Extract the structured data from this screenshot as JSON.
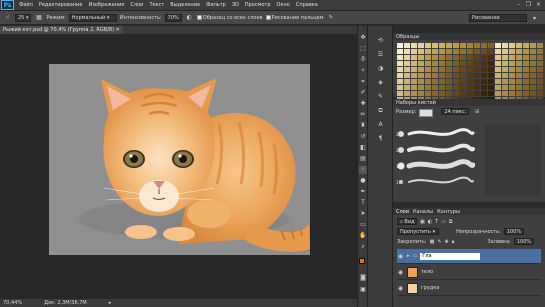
{
  "app": {
    "logo": "Ps"
  },
  "menu": [
    "Файл",
    "Редактирование",
    "Изображение",
    "Слои",
    "Текст",
    "Выделение",
    "Фильтр",
    "3D",
    "Просмотр",
    "Окно",
    "Справка"
  ],
  "window_controls": {
    "minimize": "–",
    "restore": "❐",
    "close": "✕"
  },
  "options_bar": {
    "brush_size": "25",
    "mode_label": "Режим:",
    "mode_value": "Нормальный",
    "strength_label": "Интенсивность:",
    "strength_value": "70%",
    "sample_all_layers": "Образец со всех слоев",
    "finger_painting": "Рисование пальцем",
    "workspace": "Рисование"
  },
  "document": {
    "tab_title": "Рыжий кот.psd @ 70,4% (Группа 2, RGB/8)",
    "zoom": "70,44%",
    "doc_info": "Док: 2,3M/36,7M"
  },
  "swatches_panel": {
    "title": "Образцы",
    "colors": [
      "#f5f0e0",
      "#efe6c8",
      "#e8dca8",
      "#e3d490",
      "#dccb78",
      "#d6c164",
      "#cfb652",
      "#c6aa44",
      "#bd9e38",
      "#b3922e",
      "#a88626",
      "#9c7a20",
      "#8f6e1b",
      "#826217",
      "#f3eac6",
      "#e9dba4",
      "#ddcb86",
      "#d1bb6c",
      "#c4ab58",
      "#b69b48",
      "#a78b3c",
      "#f6efd8",
      "#ede0b4",
      "#e2d08c",
      "#d8c06c",
      "#cdb05a",
      "#c3a24c",
      "#b9943e",
      "#ae8834",
      "#a27c2c",
      "#966f25",
      "#8a641f",
      "#7d581a",
      "#714d16",
      "#654212",
      "#e9d9a6",
      "#dcc784",
      "#cfb568",
      "#c1a452",
      "#b39442",
      "#a58436",
      "#97762c",
      "#f0e7c4",
      "#e4d49e",
      "#d7c17c",
      "#caaf62",
      "#bd9e4e",
      "#b08f40",
      "#a28034",
      "#94722a",
      "#866422",
      "#78571b",
      "#6b4b16",
      "#5e4011",
      "#52360e",
      "#472d0b",
      "#e2cf90",
      "#d4bc72",
      "#c6aa5c",
      "#b89a4a",
      "#aa8a3c",
      "#9c7c32",
      "#8e6e28",
      "#ebe0b8",
      "#ddcc92",
      "#cfb872",
      "#c1a65a",
      "#b39548",
      "#a5863a",
      "#97782e",
      "#896a25",
      "#7b5d1e",
      "#6e5118",
      "#614613",
      "#553c0f",
      "#49320c",
      "#3e2909",
      "#dbc684",
      "#ccb268",
      "#bea054",
      "#b09044",
      "#a28238",
      "#94742e",
      "#866724",
      "#e6dab0",
      "#d6c486",
      "#c8b068",
      "#ba9e52",
      "#ac8e42",
      "#9e7f36",
      "#90712c",
      "#826424",
      "#75581d",
      "#684d18",
      "#5c4213",
      "#50380f",
      "#452f0c",
      "#3b2709",
      "#d4be7a",
      "#c4aa60",
      "#b6984c",
      "#a8883e",
      "#9a7a32",
      "#8c6c28",
      "#7e6020",
      "#e1d4a8",
      "#d0bc7e",
      "#c1a862",
      "#b3964c",
      "#a5873e",
      "#977832",
      "#896a28",
      "#7b5e21",
      "#6e521b",
      "#614716",
      "#553d12",
      "#4a340e",
      "#3f2b0b",
      "#352308",
      "#ccb470",
      "#bca058",
      "#ae8f46",
      "#a08038",
      "#92722e",
      "#846524",
      "#77591d",
      "#dccea0",
      "#cab476",
      "#bba05c",
      "#ad8f48",
      "#9f803a",
      "#91722f",
      "#836526",
      "#76591f",
      "#6a4e1a",
      "#5e4415",
      "#523a11",
      "#47310d",
      "#3d290a",
      "#332108",
      "#c4aa68",
      "#b49852",
      "#a68840",
      "#987a34",
      "#8a6c2a",
      "#7c6022",
      "#6f541b",
      "#d6c898",
      "#c4ae70",
      "#b59a56",
      "#a78a44",
      "#997b38",
      "#8b6d2d",
      "#7e6125",
      "#72561e",
      "#664c19",
      "#5a4214",
      "#4f3910",
      "#44300d",
      "#3a280a",
      "#302007",
      "#bda262",
      "#ad924e",
      "#9f823c",
      "#917430",
      "#836828",
      "#765c20",
      "#69501a",
      "#d0c290",
      "#bea86a",
      "#af9552",
      "#a18540",
      "#937634",
      "#85692a",
      "#785d23",
      "#6c521d",
      "#604818",
      "#553f13",
      "#4a360f",
      "#402e0c",
      "#362609",
      "#2d1f07",
      "#b69c5c",
      "#a68c48",
      "#987d38",
      "#8a6f2e",
      "#7c6326",
      "#6f571f",
      "#624c18",
      "#cabc88",
      "#b8a264",
      "#a9904e",
      "#9b803e",
      "#8d7232",
      "#806528",
      "#735922",
      "#674e1c",
      "#5b4417",
      "#503b12",
      "#45330e",
      "#3b2b0b",
      "#322408",
      "#291d06",
      "#af9656",
      "#9f8644",
      "#917836",
      "#836a2c",
      "#765e24",
      "#69531d",
      "#5c4817"
    ]
  },
  "brushes_panel": {
    "title": "Наборы кистей",
    "size_label": "Размер:",
    "size_value": "24 пикс.",
    "sizes": [
      "25",
      "25",
      "17",
      "17"
    ]
  },
  "layers_panel": {
    "tabs": [
      "Слои",
      "Каналы",
      "Контуры"
    ],
    "kind_filter": "Вид",
    "blend_mode": "Пропустить",
    "opacity_label": "Непрозрачность:",
    "opacity_value": "100%",
    "lock_label": "Закрепить:",
    "fill_label": "Заливка:",
    "fill_value": "100%",
    "layers": [
      {
        "name": "Гла",
        "type": "group"
      },
      {
        "name": "тело",
        "type": "layer"
      },
      {
        "name": "грудка",
        "type": "layer"
      }
    ]
  }
}
